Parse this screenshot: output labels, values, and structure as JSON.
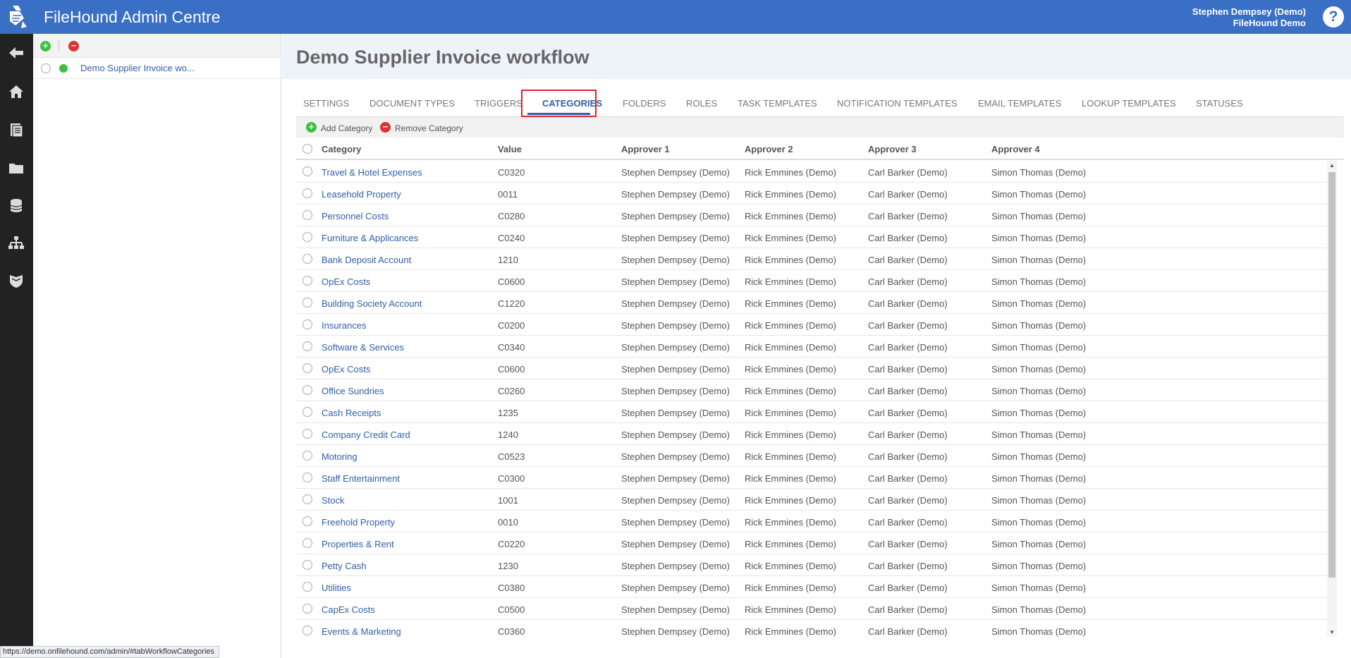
{
  "header": {
    "app_title": "FileHound Admin Centre",
    "user_name": "Stephen Dempsey (Demo)",
    "org_name": "FileHound Demo",
    "help_label": "?"
  },
  "rail": {
    "icons": [
      "back-arrow-icon",
      "home-icon",
      "document-icon",
      "folder-icon",
      "database-icon",
      "org-chart-icon",
      "shield-icon"
    ]
  },
  "tree": {
    "add_icon": "+",
    "remove_icon": "−",
    "items": [
      {
        "label": "Demo Supplier Invoice wo..."
      }
    ]
  },
  "page": {
    "title": "Demo Supplier Invoice workflow"
  },
  "tabs": [
    {
      "label": "SETTINGS"
    },
    {
      "label": "DOCUMENT TYPES"
    },
    {
      "label": "TRIGGERS"
    },
    {
      "label": "CATEGORIES",
      "active": true
    },
    {
      "label": "FOLDERS"
    },
    {
      "label": "ROLES"
    },
    {
      "label": "TASK TEMPLATES"
    },
    {
      "label": "NOTIFICATION TEMPLATES"
    },
    {
      "label": "EMAIL TEMPLATES"
    },
    {
      "label": "LOOKUP TEMPLATES"
    },
    {
      "label": "STATUSES"
    }
  ],
  "actions": {
    "add_label": "Add Category",
    "remove_label": "Remove Category"
  },
  "grid": {
    "columns": [
      "Category",
      "Value",
      "Approver 1",
      "Approver 2",
      "Approver 3",
      "Approver 4"
    ],
    "rows": [
      [
        "Travel & Hotel Expenses",
        "C0320",
        "Stephen Dempsey (Demo)",
        "Rick Emmines (Demo)",
        "Carl Barker (Demo)",
        "Simon Thomas (Demo)"
      ],
      [
        "Leasehold Property",
        "0011",
        "Stephen Dempsey (Demo)",
        "Rick Emmines (Demo)",
        "Carl Barker (Demo)",
        "Simon Thomas (Demo)"
      ],
      [
        "Personnel Costs",
        "C0280",
        "Stephen Dempsey (Demo)",
        "Rick Emmines (Demo)",
        "Carl Barker (Demo)",
        "Simon Thomas (Demo)"
      ],
      [
        "Furniture & Applicances",
        "C0240",
        "Stephen Dempsey (Demo)",
        "Rick Emmines (Demo)",
        "Carl Barker (Demo)",
        "Simon Thomas (Demo)"
      ],
      [
        "Bank Deposit Account",
        "1210",
        "Stephen Dempsey (Demo)",
        "Rick Emmines (Demo)",
        "Carl Barker (Demo)",
        "Simon Thomas (Demo)"
      ],
      [
        "OpEx Costs",
        "C0600",
        "Stephen Dempsey (Demo)",
        "Rick Emmines (Demo)",
        "Carl Barker (Demo)",
        "Simon Thomas (Demo)"
      ],
      [
        "Building Society Account",
        "C1220",
        "Stephen Dempsey (Demo)",
        "Rick Emmines (Demo)",
        "Carl Barker (Demo)",
        "Simon Thomas (Demo)"
      ],
      [
        "Insurances",
        "C0200",
        "Stephen Dempsey (Demo)",
        "Rick Emmines (Demo)",
        "Carl Barker (Demo)",
        "Simon Thomas (Demo)"
      ],
      [
        "Software & Services",
        "C0340",
        "Stephen Dempsey (Demo)",
        "Rick Emmines (Demo)",
        "Carl Barker (Demo)",
        "Simon Thomas (Demo)"
      ],
      [
        "OpEx Costs",
        "C0600",
        "Stephen Dempsey (Demo)",
        "Rick Emmines (Demo)",
        "Carl Barker (Demo)",
        "Simon Thomas (Demo)"
      ],
      [
        "Office Sundries",
        "C0260",
        "Stephen Dempsey (Demo)",
        "Rick Emmines (Demo)",
        "Carl Barker (Demo)",
        "Simon Thomas (Demo)"
      ],
      [
        "Cash Receipts",
        "1235",
        "Stephen Dempsey (Demo)",
        "Rick Emmines (Demo)",
        "Carl Barker (Demo)",
        "Simon Thomas (Demo)"
      ],
      [
        "Company Credit Card",
        "1240",
        "Stephen Dempsey (Demo)",
        "Rick Emmines (Demo)",
        "Carl Barker (Demo)",
        "Simon Thomas (Demo)"
      ],
      [
        "Motoring",
        "C0523",
        "Stephen Dempsey (Demo)",
        "Rick Emmines (Demo)",
        "Carl Barker (Demo)",
        "Simon Thomas (Demo)"
      ],
      [
        "Staff Entertainment",
        "C0300",
        "Stephen Dempsey (Demo)",
        "Rick Emmines (Demo)",
        "Carl Barker (Demo)",
        "Simon Thomas (Demo)"
      ],
      [
        "Stock",
        "1001",
        "Stephen Dempsey (Demo)",
        "Rick Emmines (Demo)",
        "Carl Barker (Demo)",
        "Simon Thomas (Demo)"
      ],
      [
        "Freehold Property",
        "0010",
        "Stephen Dempsey (Demo)",
        "Rick Emmines (Demo)",
        "Carl Barker (Demo)",
        "Simon Thomas (Demo)"
      ],
      [
        "Properties & Rent",
        "C0220",
        "Stephen Dempsey (Demo)",
        "Rick Emmines (Demo)",
        "Carl Barker (Demo)",
        "Simon Thomas (Demo)"
      ],
      [
        "Petty Cash",
        "1230",
        "Stephen Dempsey (Demo)",
        "Rick Emmines (Demo)",
        "Carl Barker (Demo)",
        "Simon Thomas (Demo)"
      ],
      [
        "Utilities",
        "C0380",
        "Stephen Dempsey (Demo)",
        "Rick Emmines (Demo)",
        "Carl Barker (Demo)",
        "Simon Thomas (Demo)"
      ],
      [
        "CapEx Costs",
        "C0500",
        "Stephen Dempsey (Demo)",
        "Rick Emmines (Demo)",
        "Carl Barker (Demo)",
        "Simon Thomas (Demo)"
      ],
      [
        "Events & Marketing",
        "C0360",
        "Stephen Dempsey (Demo)",
        "Rick Emmines (Demo)",
        "Carl Barker (Demo)",
        "Simon Thomas (Demo)"
      ]
    ]
  },
  "status_bar": {
    "url": "https://demo.onfilehound.com/admin/#tabWorkflowCategories"
  },
  "colors": {
    "header_bg": "#3a6fc6",
    "rail_bg": "#222222",
    "link": "#2f5fa8",
    "active_tab_highlight": "#d9262c",
    "add_green": "#3fbf3f",
    "remove_red": "#dd3333"
  }
}
